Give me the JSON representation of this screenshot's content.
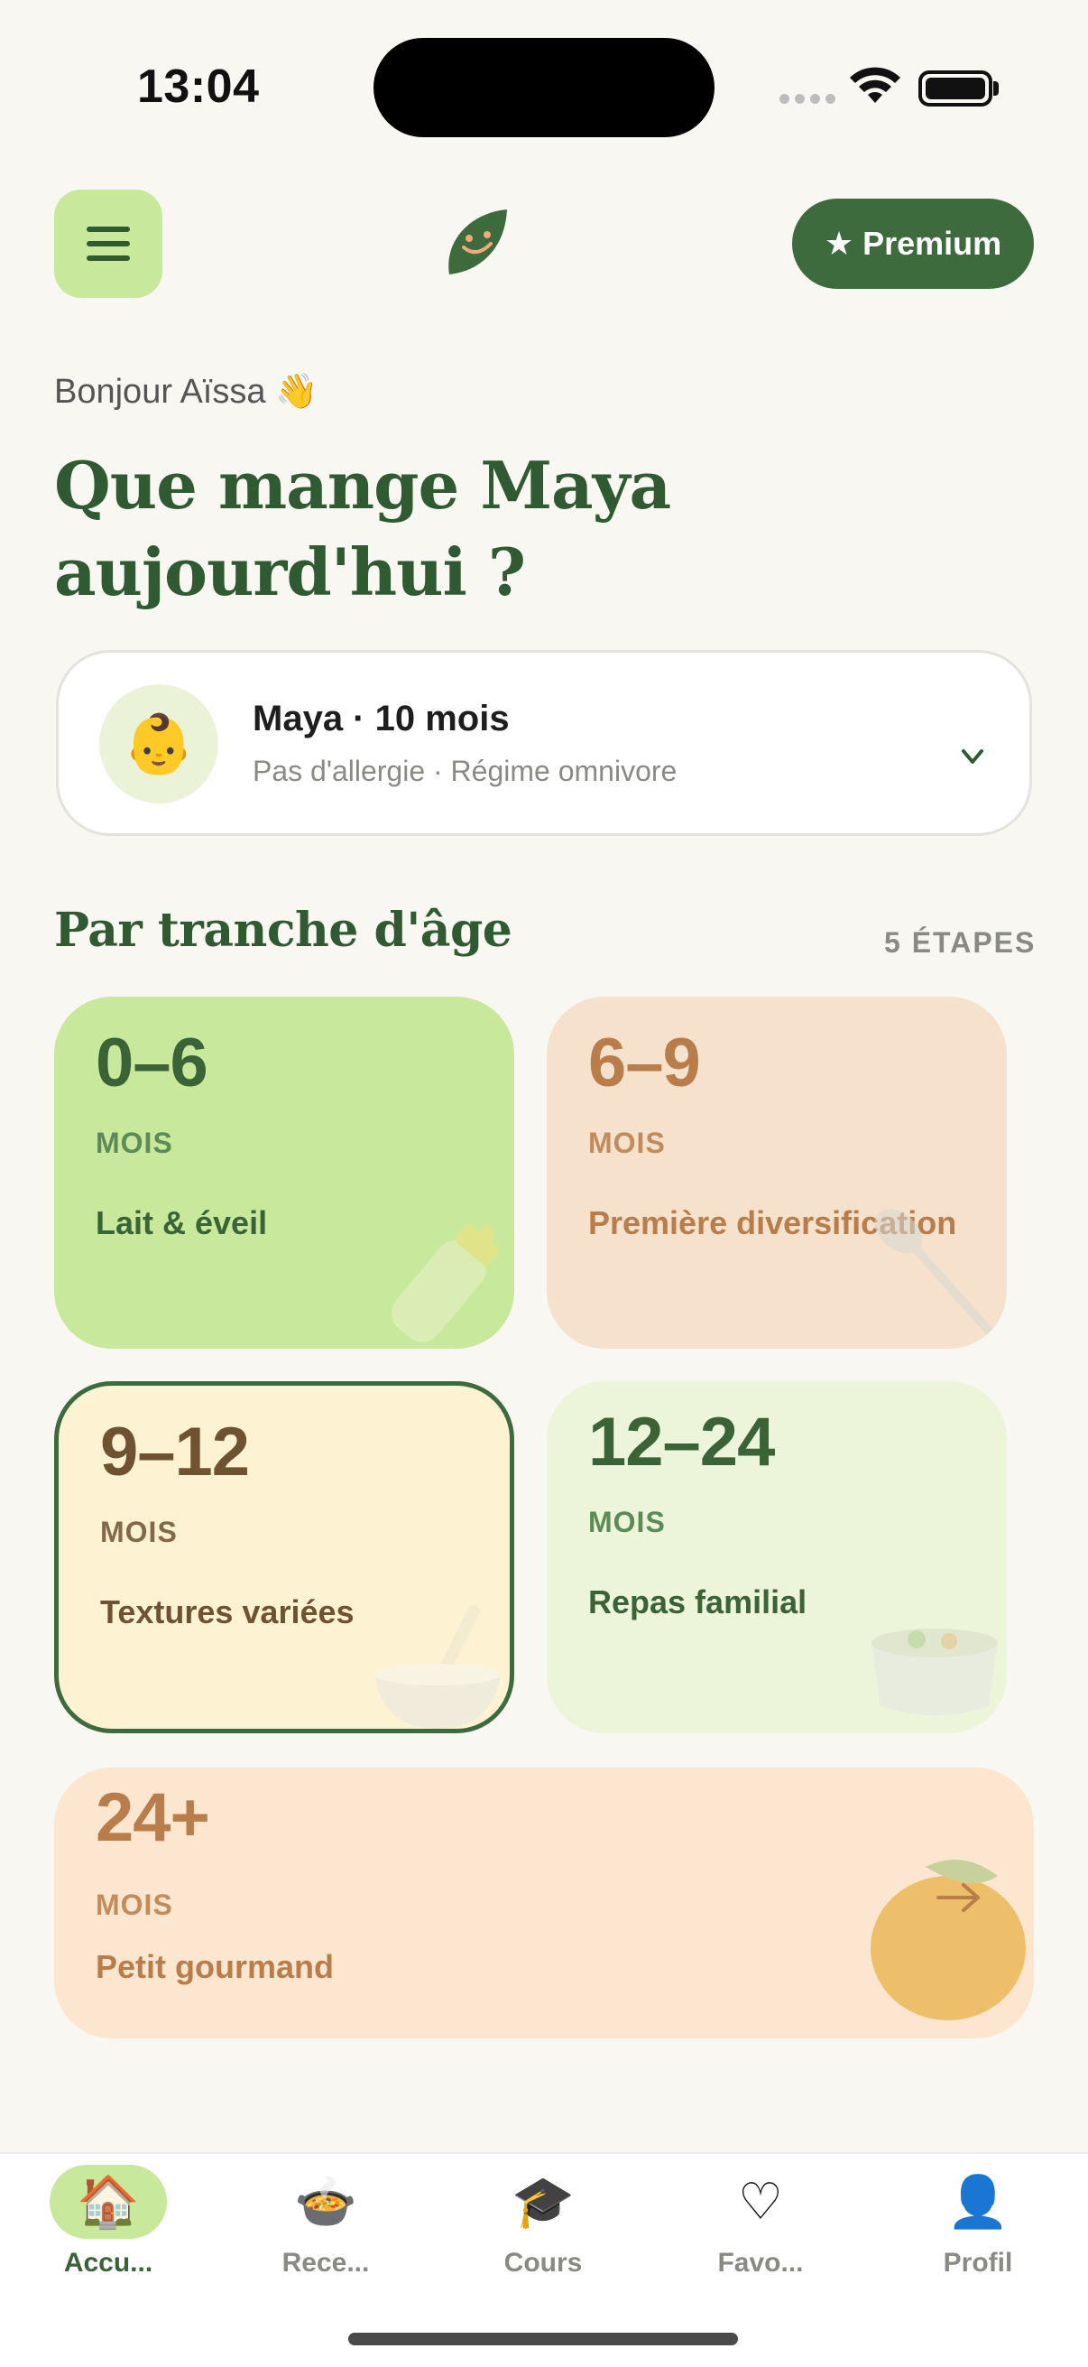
{
  "status_bar": {
    "time": "13:04"
  },
  "header": {
    "premium_label": "★ Premium",
    "icons": [
      "menu-icon",
      "leaf-logo-icon"
    ]
  },
  "greeting": {
    "hello": "Bonjour Aïssa 👋",
    "headline_line1": "Que mange Maya",
    "headline_line2": "aujourd'hui ?"
  },
  "child": {
    "avatar": "👶",
    "name": "Maya · 10 mois",
    "meta": "Pas d'allergie · Régime omnivore"
  },
  "age_section": {
    "title": "Par tranche d'âge",
    "count": "5 ÉTAPES",
    "cards": [
      {
        "range": "0–6",
        "unit": "MOIS",
        "desc": "Lait & éveil",
        "art": "bottle-icon"
      },
      {
        "range": "6–9",
        "unit": "MOIS",
        "desc": "Première diversification",
        "art": "spoon-icon"
      },
      {
        "range": "9–12",
        "unit": "MOIS",
        "desc": "Textures variées",
        "art": "bowl-icon",
        "selected": true
      },
      {
        "range": "12–24",
        "unit": "MOIS",
        "desc": "Repas familial",
        "art": "soup-pot-icon"
      },
      {
        "range": "24+",
        "unit": "MOIS",
        "desc": "Petit gourmand",
        "art": "mango-icon"
      }
    ]
  },
  "tabbar": {
    "tabs": [
      {
        "icon": "🏠",
        "label": "Accu..."
      },
      {
        "icon": "🍲",
        "label": "Rece..."
      },
      {
        "icon": "🎓",
        "label": "Cours"
      },
      {
        "icon": "♡",
        "label": "Favo..."
      },
      {
        "icon": "👤",
        "label": "Profil"
      }
    ],
    "active": 0
  },
  "colors": {
    "accent_green": "#3e6b3e",
    "light_green": "#c8e89b",
    "background": "#f9f7f2",
    "brown": "#b87d4a"
  }
}
